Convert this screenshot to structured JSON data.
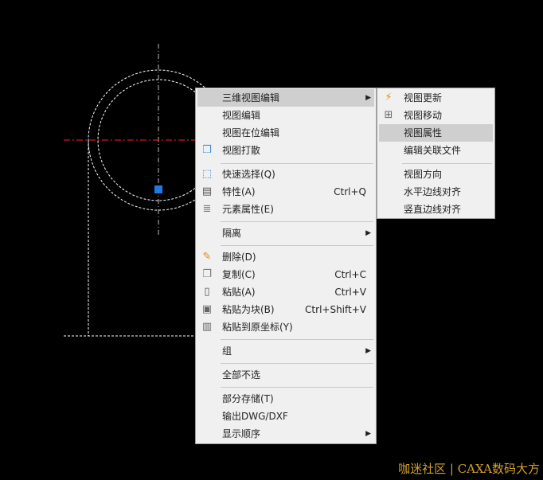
{
  "context_menu": {
    "items": [
      {
        "label": "三维视图编辑",
        "submenu": true,
        "highlighted": true
      },
      {
        "label": "视图编辑"
      },
      {
        "label": "视图在位编辑"
      },
      {
        "label": "视图打散",
        "icon": "explode-view-icon"
      },
      {
        "label": "快速选择(Q)",
        "icon": "quick-select-icon"
      },
      {
        "label": "特性(A)",
        "shortcut": "Ctrl+Q",
        "icon": "properties-icon"
      },
      {
        "label": "元素属性(E)",
        "icon": "element-attributes-icon"
      },
      {
        "label": "隔离",
        "submenu": true
      },
      {
        "label": "删除(D)",
        "icon": "eraser-icon"
      },
      {
        "label": "复制(C)",
        "shortcut": "Ctrl+C",
        "icon": "copy-icon"
      },
      {
        "label": "粘贴(A)",
        "shortcut": "Ctrl+V",
        "icon": "paste-icon"
      },
      {
        "label": "粘贴为块(B)",
        "shortcut": "Ctrl+Shift+V",
        "icon": "paste-block-icon"
      },
      {
        "label": "粘贴到原坐标(Y)",
        "icon": "paste-origin-icon"
      },
      {
        "label": "组",
        "submenu": true
      },
      {
        "label": "全部不选"
      },
      {
        "label": "部分存储(T)"
      },
      {
        "label": "输出DWG/DXF"
      },
      {
        "label": "显示顺序",
        "submenu": true
      }
    ]
  },
  "submenu": {
    "items": [
      {
        "label": "视图更新",
        "icon": "view-update-icon"
      },
      {
        "label": "视图移动",
        "icon": "view-move-icon"
      },
      {
        "label": "视图属性",
        "highlighted": true
      },
      {
        "label": "编辑关联文件"
      },
      {
        "label": "视图方向"
      },
      {
        "label": "水平边线对齐"
      },
      {
        "label": "竖直边线对齐"
      }
    ]
  },
  "watermark": "咖迷社区 | CAXA数码大方",
  "colors": {
    "center_line": "#ff2020",
    "geometry": "#ffffff",
    "grip": "#1e7be6",
    "watermark": "#d4a030"
  }
}
